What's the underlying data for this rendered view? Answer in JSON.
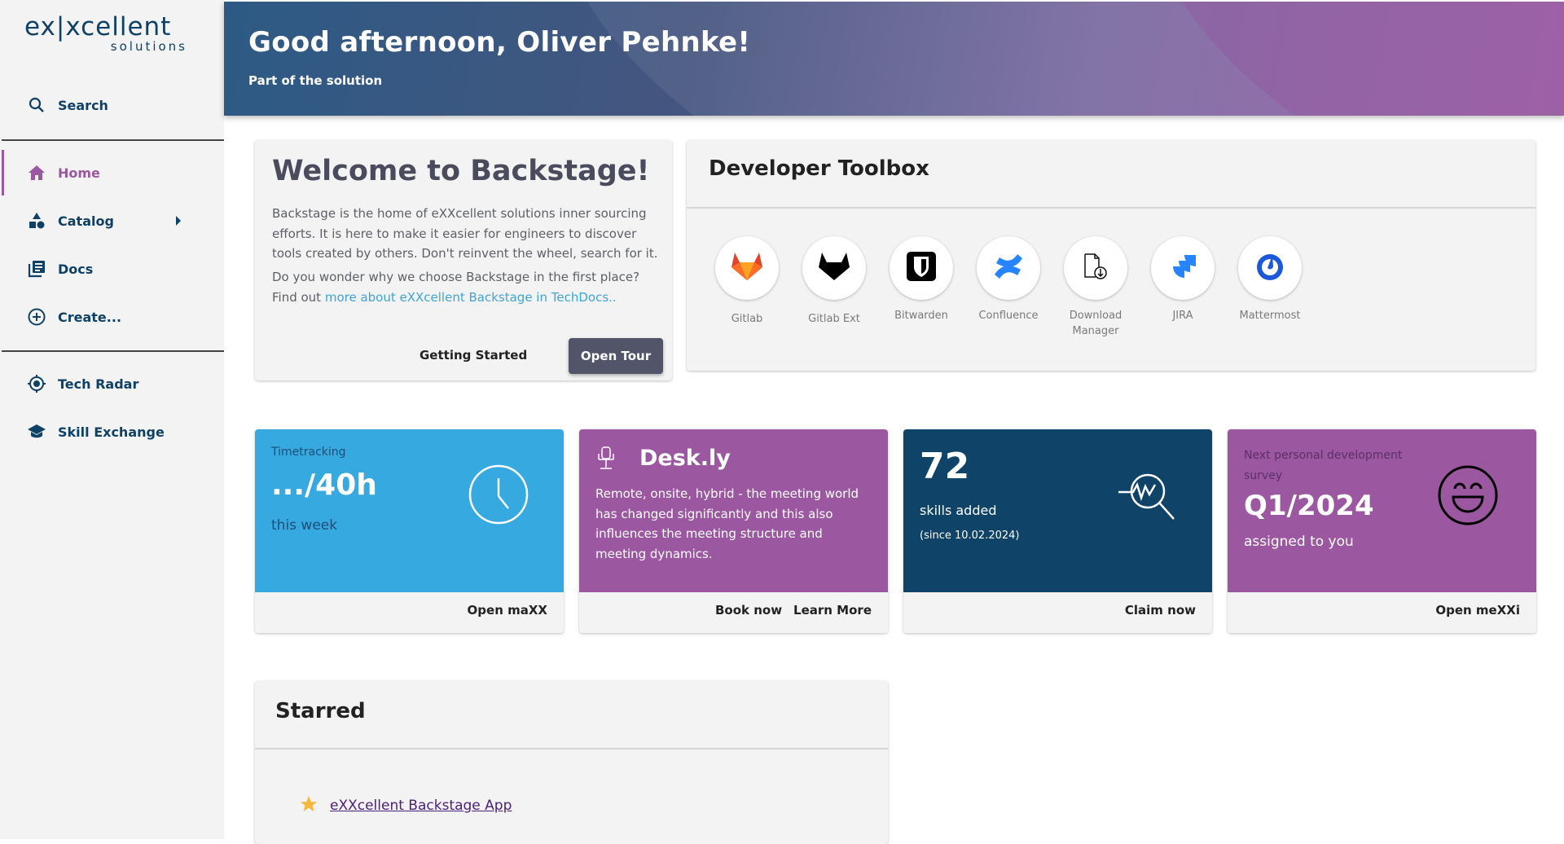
{
  "sidebar": {
    "logo": {
      "main": "ex|xcellent",
      "sub": "solutions"
    },
    "search_label": "Search",
    "items": [
      {
        "label": "Home",
        "icon": "home-icon",
        "active": true
      },
      {
        "label": "Catalog",
        "icon": "catalog-icon",
        "has_submenu": true
      },
      {
        "label": "Docs",
        "icon": "docs-icon"
      },
      {
        "label": "Create...",
        "icon": "create-icon"
      }
    ],
    "secondary_items": [
      {
        "label": "Tech Radar",
        "icon": "tech-radar-icon"
      },
      {
        "label": "Skill Exchange",
        "icon": "graduation-cap-icon"
      }
    ],
    "accent_color": "#9b57a0",
    "text_color": "#0f4066"
  },
  "header": {
    "title": "Good afternoon, Oliver Pehnke!",
    "subtitle": "Part of the solution"
  },
  "welcome": {
    "title": "Welcome to Backstage!",
    "paragraph1": "Backstage is the home of eXXcellent solutions inner sourcing efforts. It is here to make it easier for engineers to discover tools created by others. Don't reinvent the wheel, search for it.",
    "paragraph2_prefix": "Do you wonder why we choose Backstage in the first place? Find out ",
    "paragraph2_link": "more about eXXcellent Backstage in TechDocs..",
    "getting_started": "Getting Started",
    "open_tour": "Open Tour"
  },
  "toolbox": {
    "title": "Developer Toolbox",
    "tools": [
      {
        "label": "Gitlab",
        "icon": "gitlab-icon"
      },
      {
        "label": "Gitlab Ext",
        "icon": "gitlab-ext-icon"
      },
      {
        "label": "Bitwarden",
        "icon": "bitwarden-icon"
      },
      {
        "label": "Confluence",
        "icon": "confluence-icon"
      },
      {
        "label": "Download Manager",
        "icon": "download-manager-icon"
      },
      {
        "label": "JIRA",
        "icon": "jira-icon"
      },
      {
        "label": "Mattermost",
        "icon": "mattermost-icon"
      }
    ]
  },
  "tiles": {
    "timetracking": {
      "label": "Timetracking",
      "value": ".../40h",
      "sub": "this week",
      "action": "Open maXX",
      "color": "#36a9e0"
    },
    "deskly": {
      "title": "Desk.ly",
      "text": "Remote, onsite, hybrid - the meeting world has changed significantly and this also influences the meeting structure and meeting dynamics.",
      "actions": [
        "Book now",
        "Learn More"
      ],
      "color": "#9b57a0"
    },
    "skills": {
      "value": "72",
      "sub": "skills added",
      "note": "(since 10.02.2024)",
      "action": "Claim now",
      "color": "#0f4368"
    },
    "survey": {
      "label": "Next personal development survey",
      "value": "Q1/2024",
      "sub": "assigned to you",
      "action": "Open meXXi",
      "color": "#9b57a0"
    }
  },
  "starred": {
    "title": "Starred",
    "items": [
      {
        "label": "eXXcellent Backstage App",
        "icon": "star-icon"
      }
    ]
  }
}
